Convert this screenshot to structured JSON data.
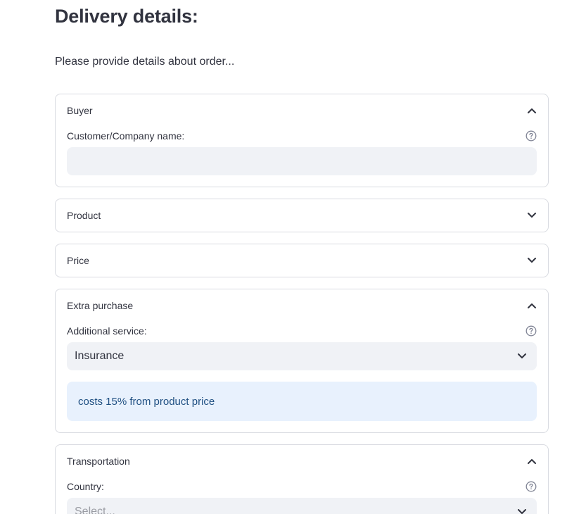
{
  "page": {
    "title": "Delivery details:",
    "intro": "Please provide details about order..."
  },
  "sections": {
    "buyer": {
      "title": "Buyer",
      "expanded": true,
      "field_label": "Customer/Company name:",
      "value": ""
    },
    "product": {
      "title": "Product",
      "expanded": false
    },
    "price": {
      "title": "Price",
      "expanded": false
    },
    "extra": {
      "title": "Extra purchase",
      "expanded": true,
      "field_label": "Additional service:",
      "selected": "Insurance",
      "info": "costs 15% from product price"
    },
    "transport": {
      "title": "Transportation",
      "expanded": true,
      "field_label": "Country:",
      "placeholder": "Select..."
    }
  },
  "colors": {
    "border": "#d9dbe1",
    "input_bg": "#f0f2f6",
    "info_bg": "#e8f1fd",
    "info_text": "#1f4f82",
    "text": "#31333f"
  },
  "icons": {
    "collapse": "chevron-up-icon",
    "expand": "chevron-down-icon",
    "help": "question-circle-icon"
  }
}
